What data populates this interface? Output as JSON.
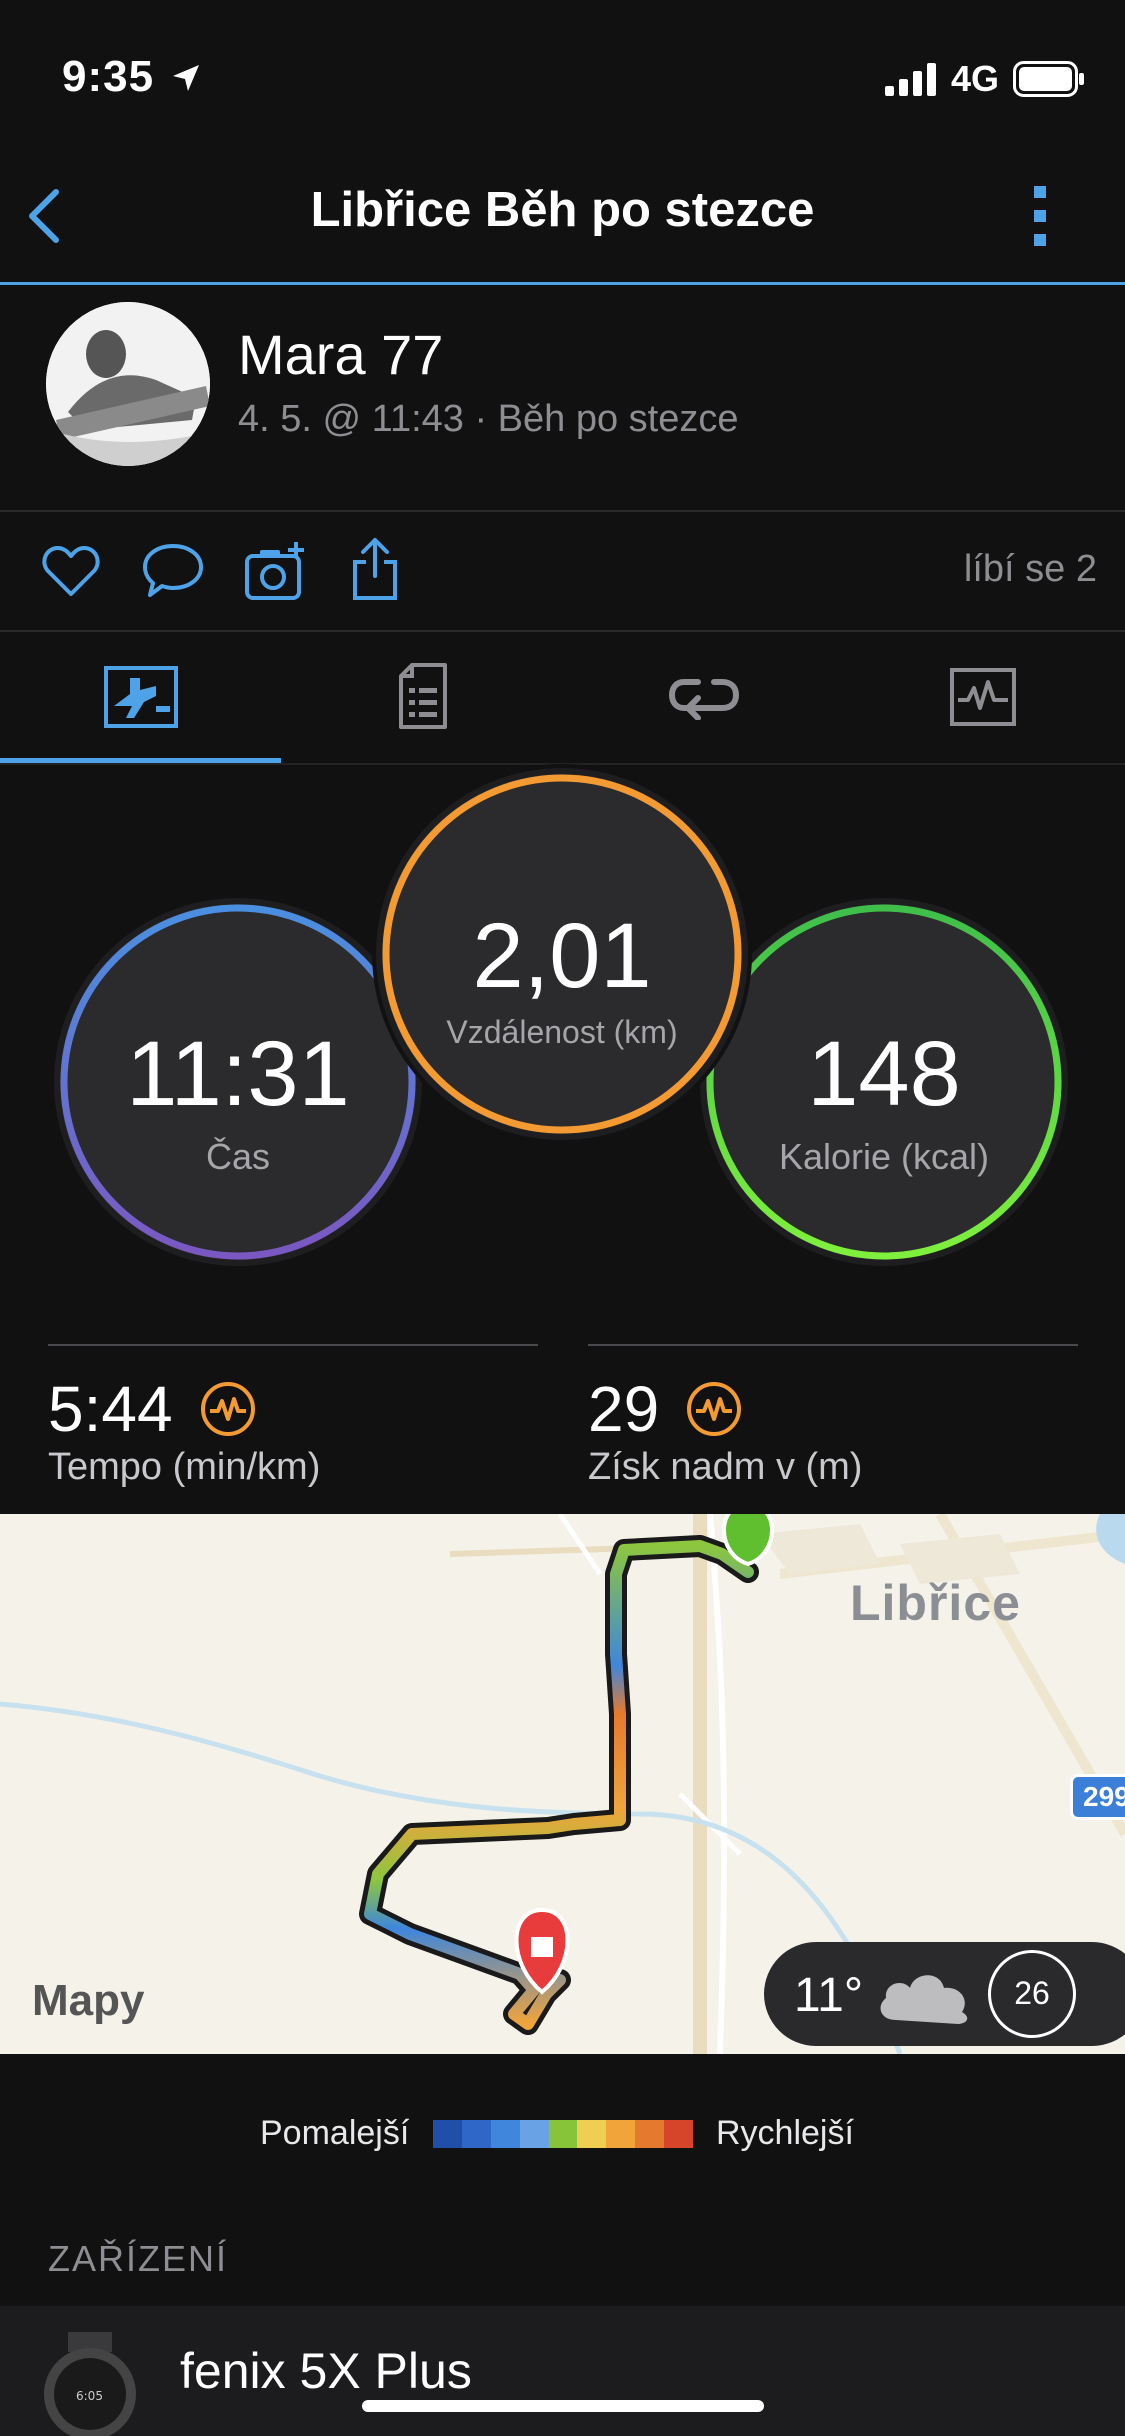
{
  "status_bar": {
    "time": "9:35",
    "network": "4G"
  },
  "nav": {
    "title": "Libřice Běh po stezce"
  },
  "profile": {
    "name": "Mara 77",
    "subtitle": "4. 5. @ 11:43 · Běh po stezce"
  },
  "actions": {
    "likes": "líbí se 2"
  },
  "metrics": {
    "time": {
      "value": "11:31",
      "label": "Čas"
    },
    "distance": {
      "value": "2,01",
      "label": "Vzdálenost (km)"
    },
    "calories": {
      "value": "148",
      "label": "Kalorie (kcal)"
    }
  },
  "stats": {
    "pace": {
      "value": "5:44",
      "label": "Tempo (min/km)"
    },
    "elevation": {
      "value": "29",
      "label": "Získ nadm v (m)"
    }
  },
  "map": {
    "town": "Libřice",
    "road_number": "299",
    "attribution": "Mapy",
    "temperature": "11°",
    "wind": "26"
  },
  "legend": {
    "slower": "Pomalejší",
    "faster": "Rychlejší",
    "colors": [
      "#1f4fa8",
      "#2e67c8",
      "#3f86dc",
      "#6aa2e6",
      "#88c43a",
      "#efcf52",
      "#f0a43a",
      "#e57a2e",
      "#d6452a"
    ]
  },
  "devices": {
    "section_title": "ZAŘÍZENÍ",
    "device_name": "fenix 5X Plus"
  },
  "accent": "#4ea3e8"
}
